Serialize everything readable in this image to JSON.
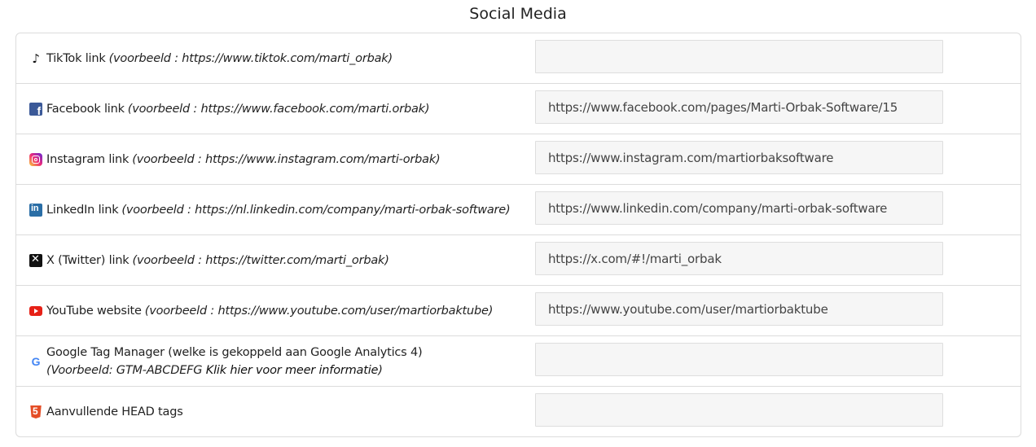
{
  "title": "Social Media",
  "rows": [
    {
      "icon": "tiktok-icon",
      "label": "TikTok link",
      "example": "(voorbeeld : https://www.tiktok.com/marti_orbak)",
      "value": ""
    },
    {
      "icon": "facebook-icon",
      "label": "Facebook link",
      "example": "(voorbeeld : https://www.facebook.com/marti.orbak)",
      "value": "https://www.facebook.com/pages/Marti-Orbak-Software/15"
    },
    {
      "icon": "instagram-icon",
      "label": "Instagram link",
      "example": "(voorbeeld : https://www.instagram.com/marti-orbak)",
      "value": "https://www.instagram.com/martiorbaksoftware"
    },
    {
      "icon": "linkedin-icon",
      "label": "LinkedIn link",
      "example": "(voorbeeld : https://nl.linkedin.com/company/marti-orbak-software)",
      "value": "https://www.linkedin.com/company/marti-orbak-software"
    },
    {
      "icon": "x-twitter-icon",
      "label": "X (Twitter) link",
      "example": "(voorbeeld : https://twitter.com/marti_orbak)",
      "value": "https://x.com/#!/marti_orbak"
    },
    {
      "icon": "youtube-icon",
      "label": "YouTube website",
      "example": "(voorbeeld : https://www.youtube.com/user/martiorbaktube)",
      "value": "https://www.youtube.com/user/martiorbaktube"
    },
    {
      "icon": "google-icon",
      "label": "Google Tag Manager (welke is gekoppeld aan Google Analytics 4)",
      "example": "(Voorbeeld: GTM-ABCDEFG",
      "more_link": "Klik hier voor meer informatie",
      "example_end": ")",
      "value": ""
    },
    {
      "icon": "html5-icon",
      "label": "Aanvullende HEAD tags",
      "value": ""
    }
  ],
  "icon_glyphs": {
    "tiktok": "♪",
    "google": "G"
  },
  "colors": {
    "facebook": "#3b5998",
    "linkedin": "#2a6ea6",
    "youtube": "#e62117",
    "html5": "#e44d26",
    "google": "#4285f4"
  }
}
